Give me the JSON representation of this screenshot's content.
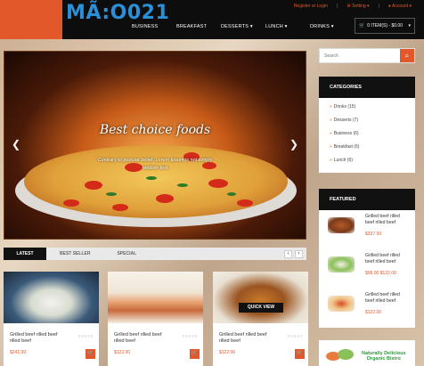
{
  "logo": {
    "text": "MÃ:O021"
  },
  "toplinks": {
    "register_login": "Register or Login",
    "setting": "Setting",
    "account": "Account"
  },
  "nav": [
    "BUSINESS",
    "BREAKFAST",
    "DESSERTS",
    "LUNCH",
    "DRINKS"
  ],
  "cart": {
    "label": "0 ITEM(S) - $0.00"
  },
  "slider": {
    "title": "Best choice foods",
    "subtitle_line1": "Contrary to popular belief, Lorem Ipsum is not simply",
    "subtitle_line2": "random text"
  },
  "tabs": {
    "latest": "LATEST",
    "bestseller": "BEST SELLER",
    "special": "SPECIAL"
  },
  "products": [
    {
      "name": "Grilled beef rilled beef rilled beef",
      "price": "$241.99",
      "stars": "○○○○○"
    },
    {
      "name": "Grilled beef rilled beef rilled beef",
      "price": "$122.00",
      "stars": "○○○○○"
    },
    {
      "name": "Grilled beef rilled beef rilled beef",
      "price": "$122.00",
      "stars": "○○○○○",
      "quick_view": "QUICK VIEW"
    }
  ],
  "search": {
    "placeholder": "Search"
  },
  "categories": {
    "title": "CATEGORIES",
    "items": [
      "Drinks (15)",
      "Desserts (7)",
      "Business (6)",
      "Breakfast (6)",
      "Lunch (6)"
    ]
  },
  "featured": {
    "title": "FEATURED",
    "items": [
      {
        "name": "Grilled beef rilled beef rilled beef",
        "price": "$337.99"
      },
      {
        "name": "Grilled beef rilled beef rilled beef",
        "price": "$98.00 $122.00"
      },
      {
        "name": "Grilled beef rilled beef rilled beef",
        "price": "$122.00"
      }
    ]
  },
  "banner": {
    "line1": "Naturally Delicious",
    "line2": "Organic Bistro"
  },
  "colors": {
    "accent": "#e2582a",
    "dark": "#111111",
    "logo": "#2a8fd6"
  }
}
